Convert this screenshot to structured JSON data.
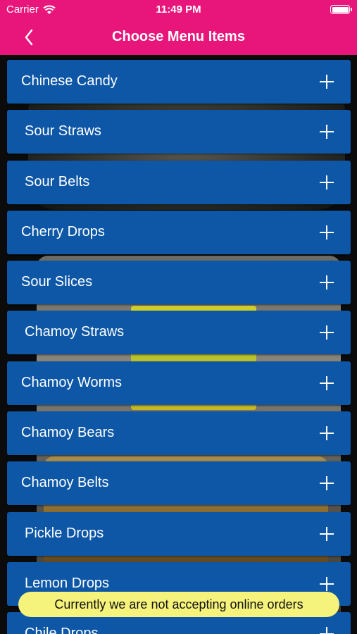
{
  "status_bar": {
    "carrier": "Carrier",
    "time": "11:49 PM",
    "wifi_icon": "wifi-icon",
    "battery_icon": "battery-icon"
  },
  "nav": {
    "title": "Choose Menu Items",
    "back_icon": "chevron-left-icon"
  },
  "menu": {
    "items": [
      {
        "label": "Chinese Candy"
      },
      {
        "label": "Sour Straws"
      },
      {
        "label": "Sour Belts"
      },
      {
        "label": "Cherry Drops"
      },
      {
        "label": "Sour Slices"
      },
      {
        "label": "Chamoy Straws"
      },
      {
        "label": "Chamoy Worms"
      },
      {
        "label": "Chamoy Bears"
      },
      {
        "label": "Chamoy Belts"
      },
      {
        "label": "Pickle Drops"
      },
      {
        "label": "Lemon Drops"
      },
      {
        "label": "Chile Drops"
      }
    ],
    "add_icon": "plus-icon"
  },
  "toast": {
    "message": "Currently we are not accepting online orders"
  },
  "colors": {
    "header": "#e8167b",
    "item_background": "#0d57a6",
    "toast_background": "#f5f37c"
  }
}
